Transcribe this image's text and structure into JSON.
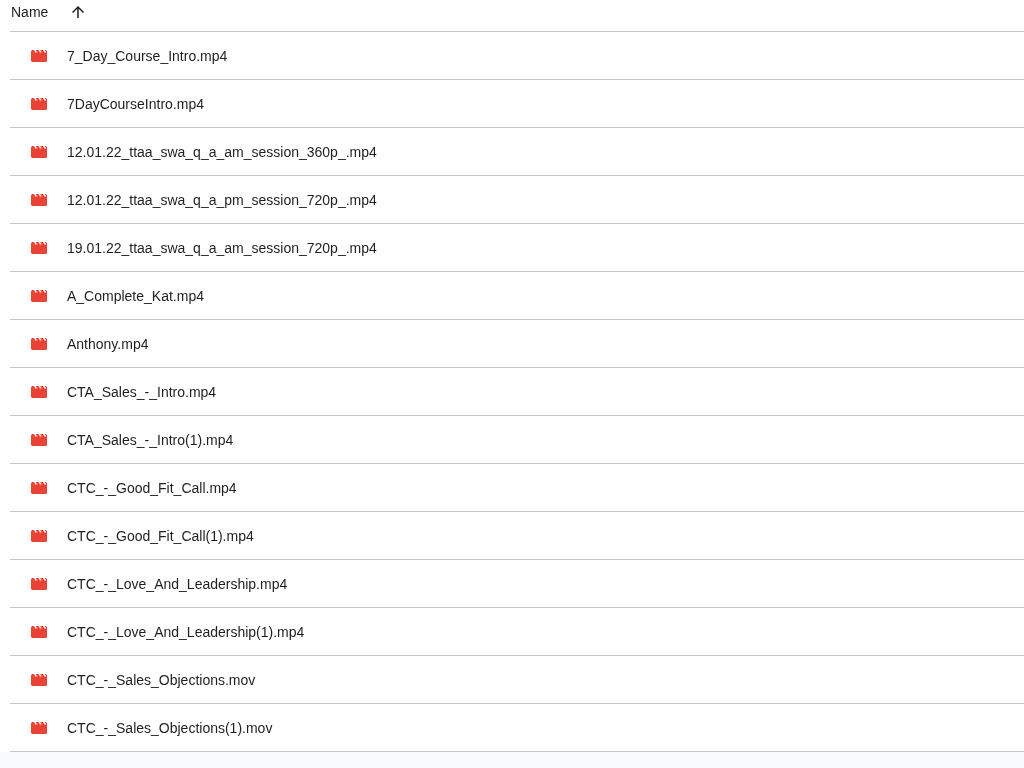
{
  "table": {
    "columns": [
      {
        "label": "Name",
        "sort_ascending": true
      }
    ],
    "rows": [
      {
        "name": "7_Day_Course_Intro.mp4"
      },
      {
        "name": "7DayCourseIntro.mp4"
      },
      {
        "name": "12.01.22_ttaa_swa_q_a_am_session_360p_.mp4"
      },
      {
        "name": "12.01.22_ttaa_swa_q_a_pm_session_720p_.mp4"
      },
      {
        "name": "19.01.22_ttaa_swa_q_a_am_session_720p_.mp4"
      },
      {
        "name": "A_Complete_Kat.mp4"
      },
      {
        "name": "Anthony.mp4"
      },
      {
        "name": "CTA_Sales_-_Intro.mp4"
      },
      {
        "name": "CTA_Sales_-_Intro(1).mp4"
      },
      {
        "name": "CTC_-_Good_Fit_Call.mp4"
      },
      {
        "name": "CTC_-_Good_Fit_Call(1).mp4"
      },
      {
        "name": "CTC_-_Love_And_Leadership.mp4"
      },
      {
        "name": "CTC_-_Love_And_Leadership(1).mp4"
      },
      {
        "name": "CTC_-_Sales_Objections.mov"
      },
      {
        "name": "CTC_-_Sales_Objections(1).mov"
      }
    ]
  }
}
